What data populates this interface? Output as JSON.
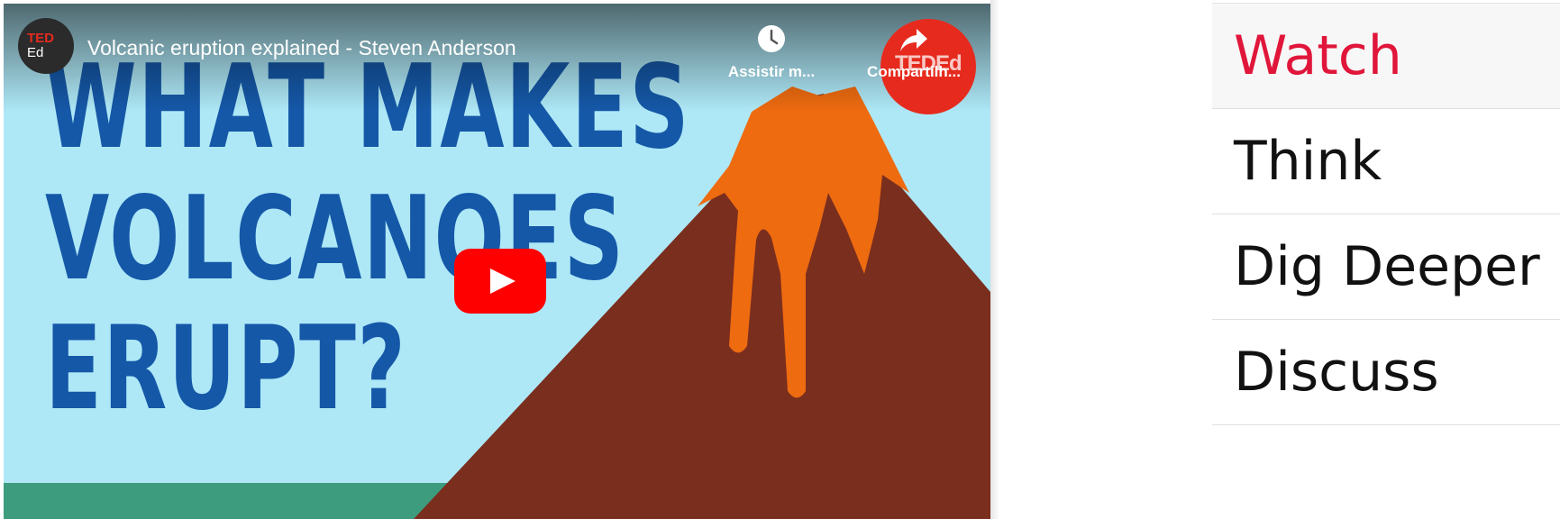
{
  "video": {
    "channel": {
      "avatar_top": "TED",
      "avatar_bottom": "Ed",
      "badge_text": "TEDEd"
    },
    "title": "Volcanic eruption explained - Steven Anderson",
    "actions": {
      "watch_later_label": "Assistir m...",
      "share_label": "Compartilh..."
    },
    "thumbnail": {
      "headline_line1": "WHAT MAKES",
      "headline_line2": "VOLCANOES",
      "headline_line3": "ERUPT?"
    },
    "icons": {
      "play": "youtube-play-icon",
      "watch_later": "clock-icon",
      "share": "share-arrow-icon"
    },
    "colors": {
      "sky": "#aee8f7",
      "headline": "#1558a8",
      "mountain": "#7a2e1e",
      "lava": "#ee6b10",
      "ground": "#3e9c7e",
      "play_red": "#ff0000",
      "ted_red": "#e62b1e"
    }
  },
  "tabs": [
    {
      "label": "Watch",
      "active": true
    },
    {
      "label": "Think",
      "active": false
    },
    {
      "label": "Dig Deeper",
      "active": false
    },
    {
      "label": "Discuss",
      "active": false
    }
  ],
  "accent_color": "#e0163a"
}
